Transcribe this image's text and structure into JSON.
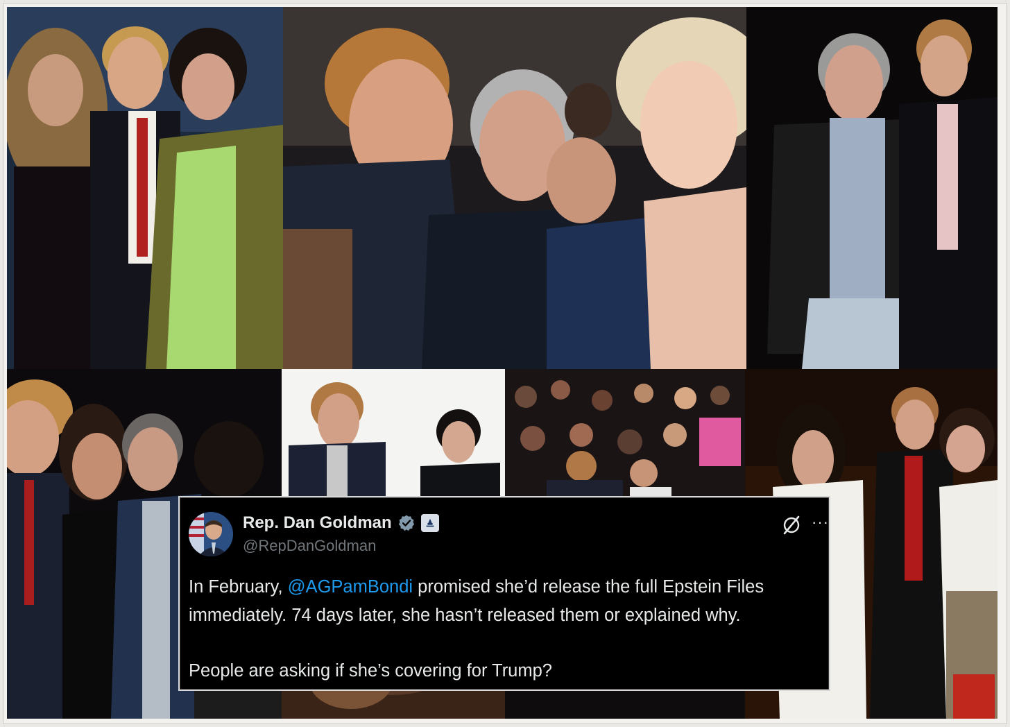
{
  "collage": {
    "photos": [
      {
        "id": "photo-1"
      },
      {
        "id": "photo-2"
      },
      {
        "id": "photo-3"
      },
      {
        "id": "photo-4"
      },
      {
        "id": "photo-5"
      },
      {
        "id": "photo-6"
      },
      {
        "id": "photo-7"
      }
    ]
  },
  "tweet": {
    "display_name": "Rep. Dan Goldman",
    "handle": "@RepDanGoldman",
    "badges": [
      "verified-icon",
      "government-badge-icon"
    ],
    "menu_icons": [
      "grok-icon",
      "more-icon"
    ],
    "more_label": "···",
    "body": {
      "line1_prefix": "In February, ",
      "mention": "@AGPamBondi",
      "line1_suffix": " promised she’d release the full Epstein Files immediately. 74 days later, she hasn’t released them or explained why.",
      "line2": "People are asking if she’s covering for Trump?"
    },
    "colors": {
      "background": "#000000",
      "text": "#e7e9ea",
      "secondary": "#71767b",
      "mention": "#1d9bf0",
      "verified": "#829aab"
    }
  }
}
